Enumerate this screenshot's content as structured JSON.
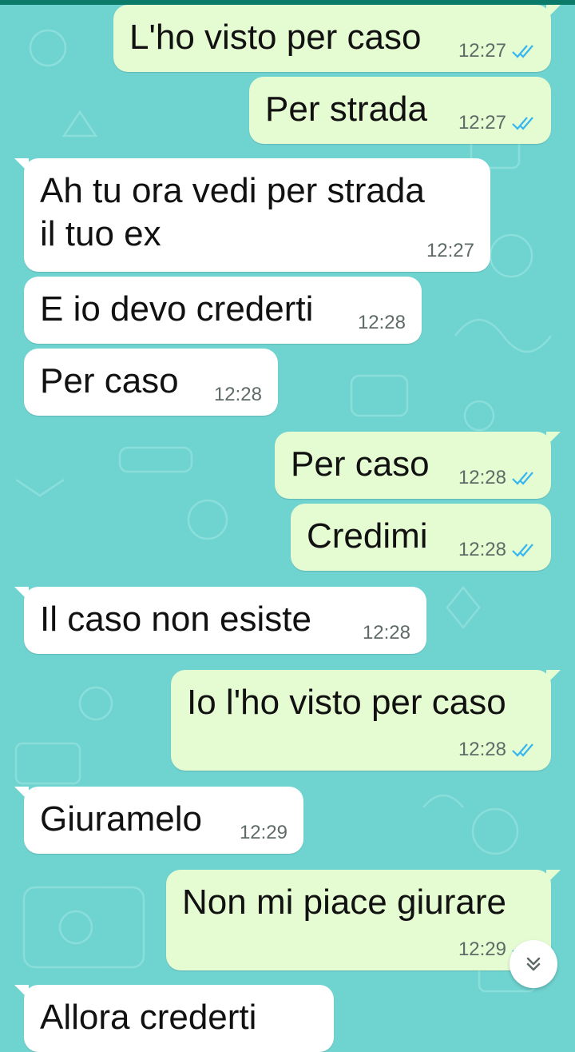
{
  "colors": {
    "wallpaper": "#6fd3d0",
    "outgoing_bubble": "#e5fbd2",
    "incoming_bubble": "#ffffff",
    "read_ticks": "#34b7f1",
    "topbar": "#0b7a69"
  },
  "messages": [
    {
      "direction": "out",
      "text": "L'ho visto per caso",
      "time": "12:27",
      "status": "read"
    },
    {
      "direction": "out",
      "text": "Per strada",
      "time": "12:27",
      "status": "read"
    },
    {
      "direction": "in",
      "text": "Ah tu ora vedi per strada\nil tuo ex",
      "time": "12:27"
    },
    {
      "direction": "in",
      "text": "E io devo crederti",
      "time": "12:28"
    },
    {
      "direction": "in",
      "text": "Per caso",
      "time": "12:28"
    },
    {
      "direction": "out",
      "text": "Per caso",
      "time": "12:28",
      "status": "read"
    },
    {
      "direction": "out",
      "text": "Credimi",
      "time": "12:28",
      "status": "read"
    },
    {
      "direction": "in",
      "text": "Il caso non esiste",
      "time": "12:28"
    },
    {
      "direction": "out",
      "text": "Io l'ho visto per caso",
      "time": "12:28",
      "status": "read"
    },
    {
      "direction": "in",
      "text": "Giuramelo",
      "time": "12:29"
    },
    {
      "direction": "out",
      "text": "Non mi piace giurare",
      "time": "12:29",
      "status": "read"
    },
    {
      "direction": "in",
      "text": "Allora crederti",
      "time": ""
    }
  ],
  "scroll_button": {
    "icon": "chevron-double-down-icon"
  }
}
